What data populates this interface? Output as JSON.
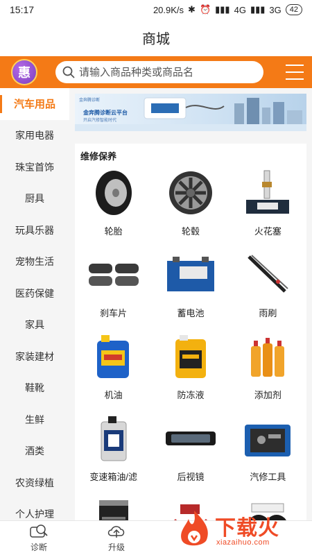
{
  "status": {
    "time": "15:17",
    "speed": "20.9K/s",
    "net1": "4G",
    "net2": "3G",
    "battery": "42"
  },
  "header": {
    "title": "商城"
  },
  "search": {
    "avatar_char": "惠",
    "placeholder": "请输入商品种类或商品名"
  },
  "sidebar": {
    "items": [
      {
        "label": "汽车用品"
      },
      {
        "label": "家用电器"
      },
      {
        "label": "珠宝首饰"
      },
      {
        "label": "厨具"
      },
      {
        "label": "玩具乐器"
      },
      {
        "label": "宠物生活"
      },
      {
        "label": "医药保健"
      },
      {
        "label": "家具"
      },
      {
        "label": "家装建材"
      },
      {
        "label": "鞋靴"
      },
      {
        "label": "生鲜"
      },
      {
        "label": "酒类"
      },
      {
        "label": "农资绿植"
      },
      {
        "label": "个人护理"
      }
    ]
  },
  "banner": {
    "logo": "金奔腾诊断",
    "headline": "金奔腾诊断云平台",
    "sub": "开启汽修智能时代"
  },
  "section": {
    "title": "维修保养",
    "items": [
      {
        "label": "轮胎",
        "icon": "tire-icon"
      },
      {
        "label": "轮毂",
        "icon": "wheel-rim-icon"
      },
      {
        "label": "火花塞",
        "icon": "spark-plug-icon"
      },
      {
        "label": "刹车片",
        "icon": "brake-pad-icon"
      },
      {
        "label": "蓄电池",
        "icon": "battery-icon"
      },
      {
        "label": "雨刷",
        "icon": "wiper-icon"
      },
      {
        "label": "机油",
        "icon": "engine-oil-icon"
      },
      {
        "label": "防冻液",
        "icon": "antifreeze-icon"
      },
      {
        "label": "添加剂",
        "icon": "additive-icon"
      },
      {
        "label": "变速箱油/滤",
        "icon": "transmission-oil-icon"
      },
      {
        "label": "后视镜",
        "icon": "mirror-icon"
      },
      {
        "label": "汽修工具",
        "icon": "toolbox-icon"
      },
      {
        "label": "",
        "icon": "oil-filter-icon"
      },
      {
        "label": "",
        "icon": "jumper-cable-icon"
      },
      {
        "label": "",
        "icon": "horn-icon"
      }
    ]
  },
  "tabs": [
    {
      "label": "诊断",
      "icon": "diagnose-icon"
    },
    {
      "label": "升级",
      "icon": "cloud-upgrade-icon"
    }
  ],
  "watermark": {
    "text": "下载火",
    "sub": "xiazaihuo.com"
  },
  "colors": {
    "accent": "#f47a16",
    "watermark": "#ef4b26"
  }
}
